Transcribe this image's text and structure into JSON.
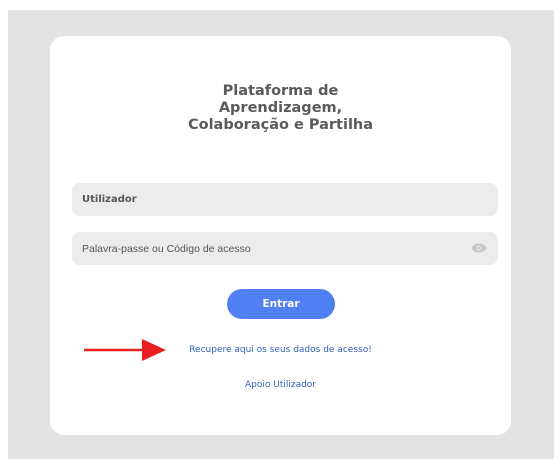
{
  "login": {
    "title_lines": [
      "Plataforma de",
      "Aprendizagem,",
      "Colaboração e Partilha"
    ],
    "username_placeholder": "Utilizador",
    "password_placeholder": "Palavra-passe ou Código de acesso",
    "password_toggle_icon": "eye-icon",
    "submit_label": "Entrar",
    "recover_link": "Recupere aqui os seus dados de acesso!",
    "support_link": "Apoio Utilizador"
  },
  "annotation": {
    "arrow_icon": "red-arrow-icon",
    "arrow_color": "#e8201f"
  },
  "colors": {
    "background": "#e3e3e3",
    "card": "#ffffff",
    "field": "#ececec",
    "button": "#4f7ff2",
    "link": "#2f5fb8"
  }
}
